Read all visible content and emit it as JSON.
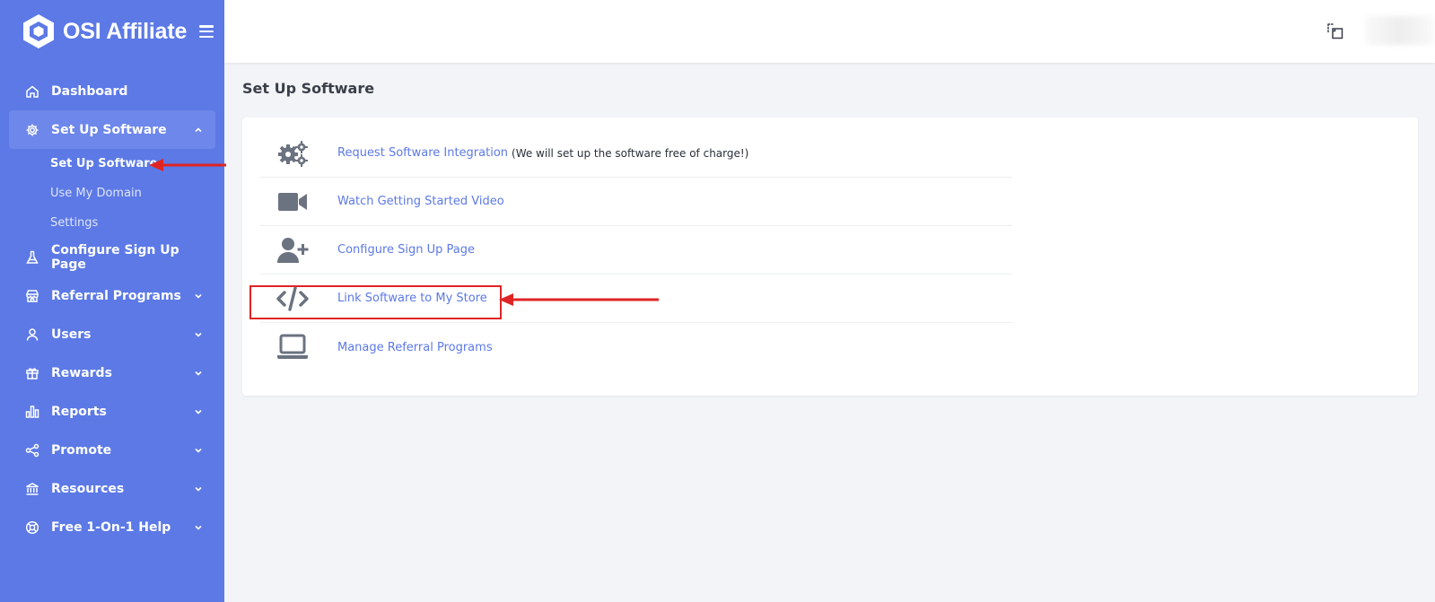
{
  "brand": {
    "name": "OSI Affiliate"
  },
  "sidebar": {
    "items": [
      {
        "label": "Dashboard",
        "icon": "home-icon"
      },
      {
        "label": "Set Up Software",
        "icon": "gear-icon",
        "sub": [
          {
            "label": "Set Up Software"
          },
          {
            "label": "Use My Domain"
          },
          {
            "label": "Settings"
          }
        ]
      },
      {
        "label": "Configure Sign Up Page",
        "icon": "flask-icon"
      },
      {
        "label": "Referral Programs",
        "icon": "store-icon"
      },
      {
        "label": "Users",
        "icon": "user-icon"
      },
      {
        "label": "Rewards",
        "icon": "gift-icon"
      },
      {
        "label": "Reports",
        "icon": "bar-chart-icon"
      },
      {
        "label": "Promote",
        "icon": "share-icon"
      },
      {
        "label": "Resources",
        "icon": "bank-icon"
      },
      {
        "label": "Free 1-On-1 Help",
        "icon": "lifebuoy-icon"
      }
    ]
  },
  "main": {
    "title": "Set Up Software",
    "rows": [
      {
        "label": "Request Software Integration",
        "note": "(We will set up the software free of charge!)",
        "icon": "cogs-icon"
      },
      {
        "label": "Watch Getting Started Video",
        "note": "",
        "icon": "video-camera-icon"
      },
      {
        "label": "Configure Sign Up Page",
        "note": "",
        "icon": "user-plus-icon"
      },
      {
        "label": "Link Software to My Store",
        "note": "",
        "icon": "code-icon"
      },
      {
        "label": "Manage Referral Programs",
        "note": "",
        "icon": "laptop-icon"
      }
    ]
  },
  "colors": {
    "sidebar": "#5c79e6",
    "link": "#5c79e6",
    "annotation": "#e02424"
  }
}
